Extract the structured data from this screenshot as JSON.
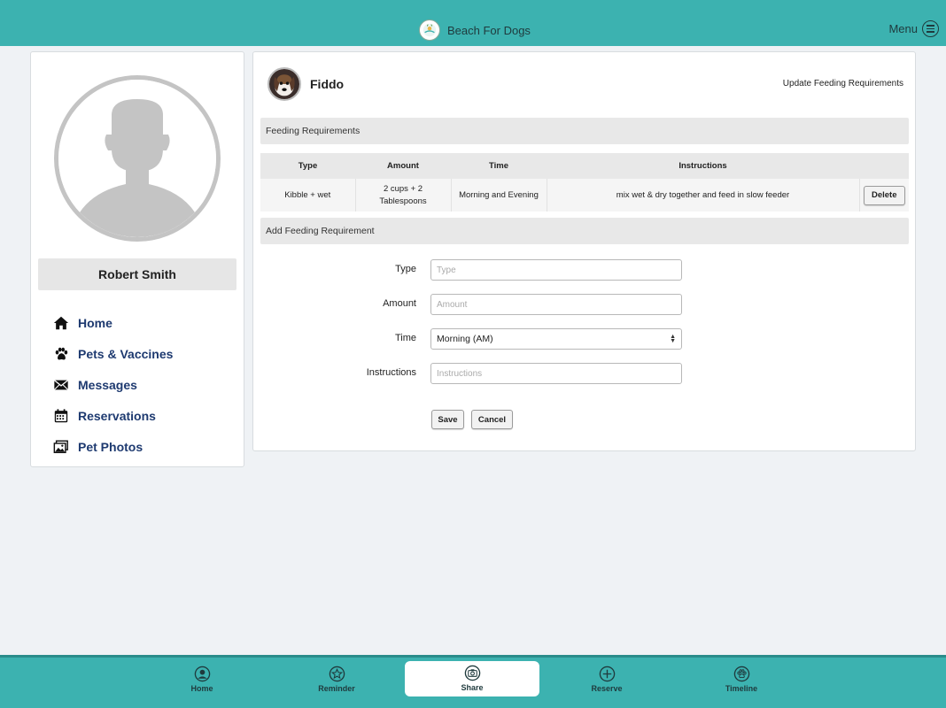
{
  "header": {
    "title": "Beach For Dogs",
    "menu_label": "Menu"
  },
  "sidebar": {
    "user_name": "Robert Smith",
    "items": [
      {
        "label": "Home",
        "icon": "home-icon"
      },
      {
        "label": "Pets & Vaccines",
        "icon": "paw-icon"
      },
      {
        "label": "Messages",
        "icon": "envelope-icon"
      },
      {
        "label": "Reservations",
        "icon": "calendar-icon"
      },
      {
        "label": "Pet Photos",
        "icon": "photos-icon"
      }
    ]
  },
  "main": {
    "pet_name": "Fiddo",
    "update_link": "Update Feeding Requirements",
    "feeding_section_title": "Feeding Requirements",
    "table": {
      "headers": [
        "Type",
        "Amount",
        "Time",
        "Instructions",
        ""
      ],
      "rows": [
        {
          "type": "Kibble + wet",
          "amount": "2 cups + 2 Tablespoons",
          "time": "Morning and Evening",
          "instructions": "mix wet & dry together and feed in slow feeder",
          "action": "Delete"
        }
      ]
    },
    "add_section_title": "Add Feeding Requirement",
    "form": {
      "type_label": "Type",
      "type_placeholder": "Type",
      "amount_label": "Amount",
      "amount_placeholder": "Amount",
      "time_label": "Time",
      "time_value": "Morning (AM)",
      "instructions_label": "Instructions",
      "instructions_placeholder": "Instructions",
      "save_label": "Save",
      "cancel_label": "Cancel"
    }
  },
  "tabbar": {
    "tabs": [
      {
        "label": "Home",
        "icon": "user-circle-icon"
      },
      {
        "label": "Reminder",
        "icon": "star-icon"
      },
      {
        "label": "Share",
        "icon": "camera-icon",
        "active": true
      },
      {
        "label": "Reserve",
        "icon": "plus-circle-icon"
      },
      {
        "label": "Timeline",
        "icon": "paw-circle-icon"
      }
    ]
  },
  "colors": {
    "brand": "#3cb2b0",
    "nav_text": "#1e3a70",
    "background": "#eff2f5"
  }
}
